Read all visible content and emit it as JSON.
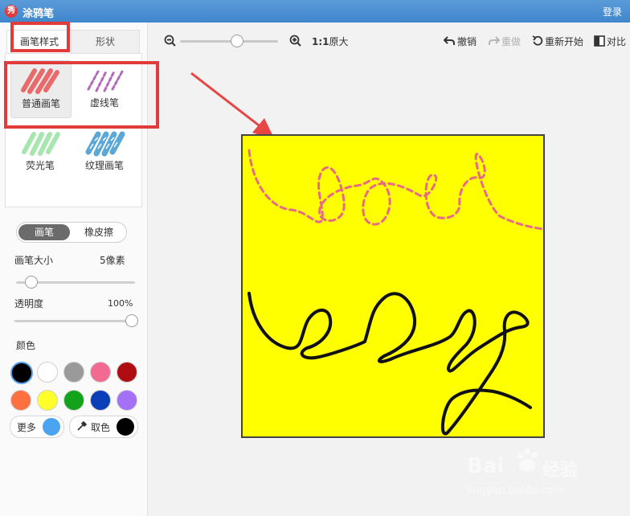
{
  "titlebar": {
    "app_icon": "秀",
    "title": "涂鸦笔",
    "login": "登录"
  },
  "tabs": {
    "brush_style": "画笔样式",
    "shape": "形状"
  },
  "brushes": [
    {
      "label": "普通画笔",
      "color": "#e86a6a",
      "selected": true
    },
    {
      "label": "虚线笔",
      "color": "#b36ab8"
    },
    {
      "label": "荧光笔",
      "color": "#a8e6b0"
    },
    {
      "label": "纹理画笔",
      "color": "#5ba7d6"
    }
  ],
  "mode": {
    "brush": "画笔",
    "eraser": "橡皮擦"
  },
  "brush_size": {
    "label": "画笔大小",
    "value": "5像素",
    "level": 0.08
  },
  "opacity": {
    "label": "透明度",
    "value": "100%",
    "level": 1.0
  },
  "colors": {
    "label": "颜色",
    "swatches": [
      "#000000",
      "#ffffff",
      "#9a9a9a",
      "#f06a91",
      "#b00d12",
      "#ff7040",
      "#ffff2a",
      "#13a31b",
      "#0a3fb8",
      "#a470f5"
    ],
    "more_label": "更多",
    "more_color": "#4aa4ef",
    "picker_label": "取色",
    "picker_color": "#000000"
  },
  "toolbar": {
    "zoom_label": "1:1",
    "zoom_suffix": "原大",
    "zoom_level": 0.5,
    "undo": "撤销",
    "redo": "重做",
    "restart": "重新开始",
    "compare": "对比"
  },
  "canvas": {
    "background": "#ffff00"
  },
  "watermark": {
    "brand": "Bai",
    "brand_cn": "经验",
    "url": "jingyan.baidu.com"
  }
}
